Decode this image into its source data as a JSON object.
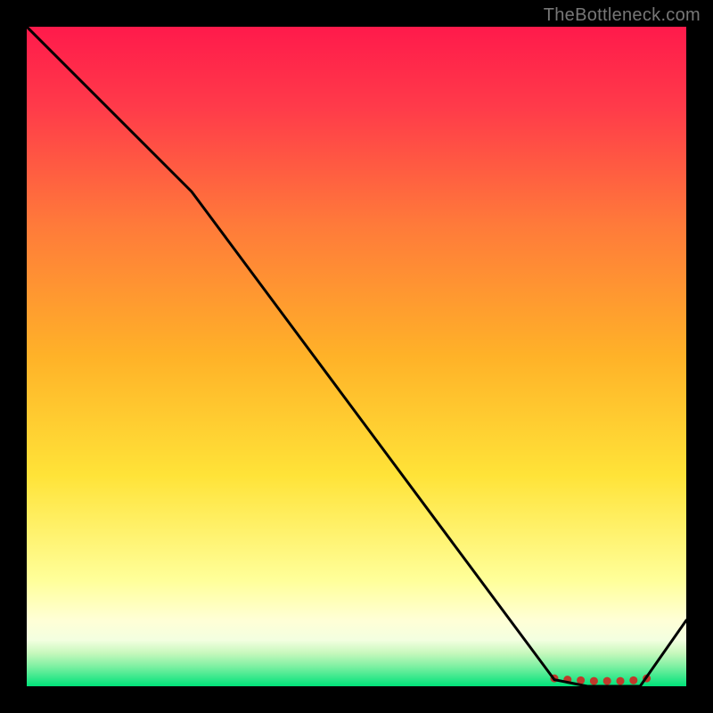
{
  "attribution": "TheBottleneck.com",
  "chart_data": {
    "type": "line",
    "title": "",
    "xlabel": "",
    "ylabel": "",
    "xlim": [
      0,
      100
    ],
    "ylim": [
      0,
      100
    ],
    "grid": false,
    "x": [
      0,
      25,
      80,
      85,
      88,
      93,
      100
    ],
    "values": [
      100,
      75,
      1,
      0,
      0,
      0,
      10
    ],
    "colors": {
      "line": "#000000",
      "top": "#ff1a4b",
      "middle": "#ffd400",
      "pale": "#ffffbf",
      "bottom": "#00e27a",
      "dots": "#c0392b"
    },
    "dots": [
      {
        "x": 80,
        "y": 1.2
      },
      {
        "x": 82,
        "y": 1.0
      },
      {
        "x": 84,
        "y": 0.9
      },
      {
        "x": 86,
        "y": 0.8
      },
      {
        "x": 88,
        "y": 0.8
      },
      {
        "x": 90,
        "y": 0.8
      },
      {
        "x": 92,
        "y": 0.9
      },
      {
        "x": 94,
        "y": 1.2
      }
    ]
  }
}
